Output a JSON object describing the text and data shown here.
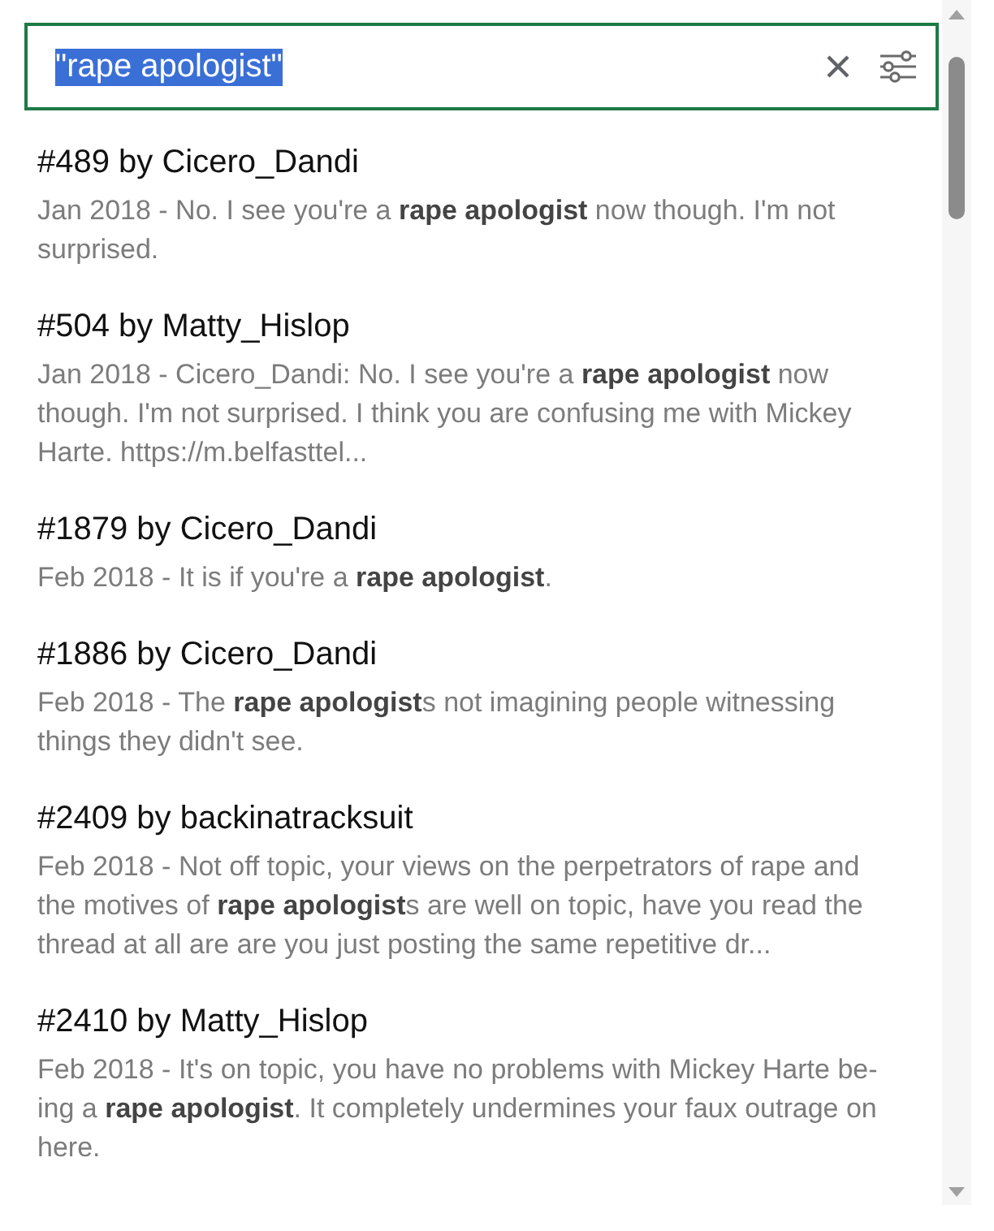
{
  "search": {
    "value": "\"rape apologist\"",
    "selected": true
  },
  "results": [
    {
      "title": "#489 by Cicero_Dandi",
      "snippet": "Jan 2018 - No. I see you're a **rape apologist** now though. I'm not surprised."
    },
    {
      "title": "#504 by Matty_Hislop",
      "snippet": "Jan 2018 - Cicero_Dandi: No. I see you're a **rape apologist** now though. I'm not surprised. I think you are confusing me with Mickey Harte. https://m.belfasttel..."
    },
    {
      "title": "#1879 by Cicero_Dandi",
      "snippet": "Feb 2018 - It is if you're a **rape apologist**."
    },
    {
      "title": "#1886 by Cicero_Dandi",
      "snippet": "Feb 2018 - The **rape apologist**s not imagining people witnessing things they didn't see."
    },
    {
      "title": "#2409 by backinatracksuit",
      "snippet": "Feb 2018 - Not off topic, your views on the perpetrators of rape and the motives of **rape apologist**s are well on topic, have you read the thread at all are are you just posting the same repetitive dr..."
    },
    {
      "title": "#2410 by Matty_Hislop",
      "snippet": "Feb 2018 - It's on topic, you have no problems with Mickey Harte be-ing a **rape apologist**. It completely undermines your faux outrage on here."
    }
  ]
}
